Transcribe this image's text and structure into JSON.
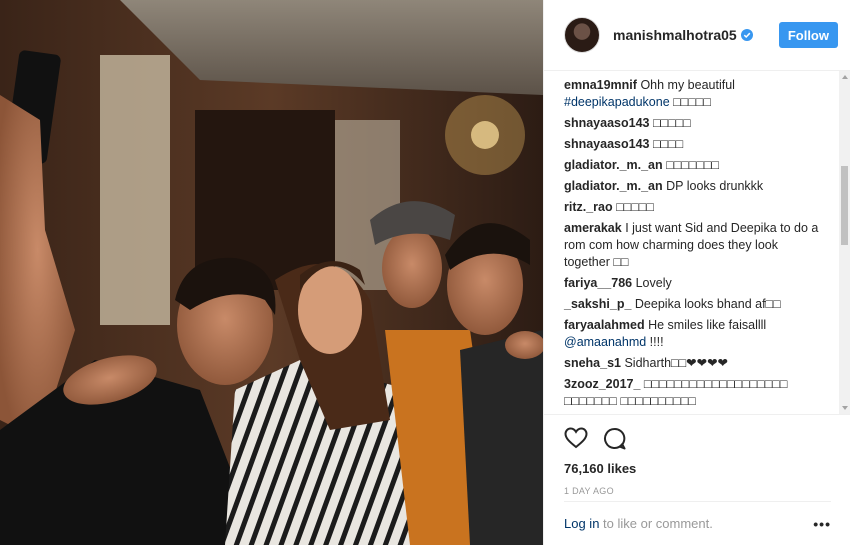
{
  "header": {
    "username": "manishmalhotra05",
    "follow_label": "Follow"
  },
  "comments": [
    {
      "user": "emna19mnif",
      "text": "Ohh my beautiful",
      "tag": "#deepikapadukone",
      "suffix": " □□□□□"
    },
    {
      "user": "shnayaaso143",
      "text": "□□□□□"
    },
    {
      "user": "shnayaaso143",
      "text": "□□□□"
    },
    {
      "user": "gladiator._m._an",
      "text": "□□□□□□□"
    },
    {
      "user": "gladiator._m._an",
      "text": "DP looks drunkkk"
    },
    {
      "user": "ritz._rao",
      "text": "□□□□□"
    },
    {
      "user": "amerakak",
      "text": "I just want Sid and Deepika to do a rom com how charming does they look together □□"
    },
    {
      "user": "fariya__786",
      "text": "Lovely"
    },
    {
      "user": "_sakshi_p_",
      "text": "Deepika looks bhand af□□"
    },
    {
      "user": "faryaalahmed",
      "text": "He smiles like faisallll",
      "tag": "@amaanahmd",
      "suffix": " !!!!"
    },
    {
      "user": "sneha_s1",
      "text": "Sidharth□□❤❤❤❤"
    },
    {
      "user": "3zooz_2017_",
      "text": "□□□□□□□□□□□□□□□□□□□ □□□□□□□ □□□□□□□□□□"
    }
  ],
  "post": {
    "likes": "76,160 likes",
    "time_ago": "1 DAY AGO"
  },
  "footer": {
    "login_link": "Log in",
    "login_rest": " to like or comment.",
    "more_label": "•••"
  },
  "icons": {
    "like": "heart-icon",
    "comment": "comment-icon",
    "verified": "verified-badge-icon",
    "more": "more-options-icon"
  },
  "colors": {
    "accent": "#3897f0",
    "link": "#003569",
    "muted": "#999999"
  }
}
